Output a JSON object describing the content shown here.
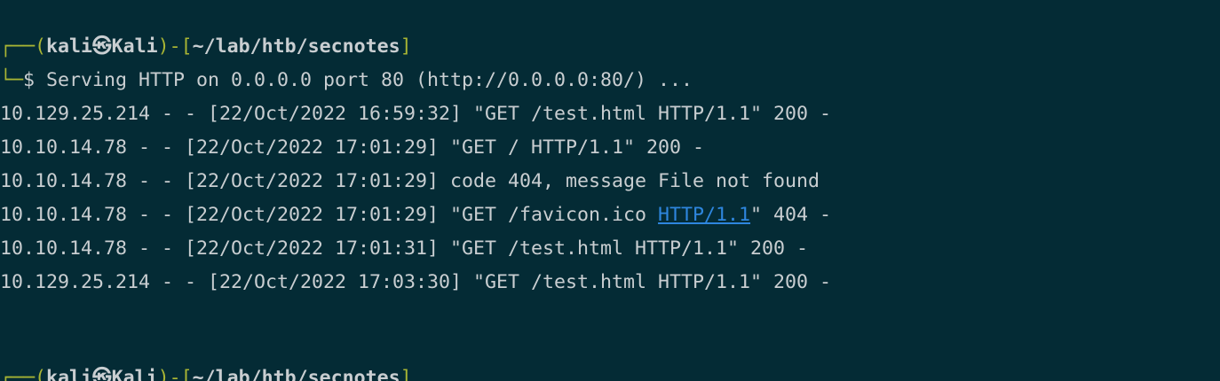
{
  "prompt1": {
    "top_corner": "┌──(",
    "user": "kali㉿Kali",
    "mid": ")-[",
    "dir": "~/lab/htb/secnotes",
    "end": "]",
    "bottom_corner": "└─",
    "dollar": "$ ",
    "command_output": "Serving HTTP on 0.0.0.0 port 80 (http://0.0.0.0:80/) ..."
  },
  "log_lines": [
    "10.129.25.214 - - [22/Oct/2022 16:59:32] \"GET /test.html HTTP/1.1\" 200 -",
    "10.10.14.78 - - [22/Oct/2022 17:01:29] \"GET / HTTP/1.1\" 200 -",
    "10.10.14.78 - - [22/Oct/2022 17:01:29] code 404, message File not found"
  ],
  "favicon_line": {
    "before": "10.10.14.78 - - [22/Oct/2022 17:01:29] \"GET /favicon.ico ",
    "link": "HTTP/1.1",
    "after": "\" 404 -"
  },
  "log_lines_after": [
    "10.10.14.78 - - [22/Oct/2022 17:01:31] \"GET /test.html HTTP/1.1\" 200 -",
    "10.129.25.214 - - [22/Oct/2022 17:03:30] \"GET /test.html HTTP/1.1\" 200 -"
  ],
  "prompt2": {
    "top_corner": "┌──(",
    "user": "kali㉿Kali",
    "mid": ")-[",
    "dir": "~/lab/htb/secnotes",
    "end": "]"
  }
}
